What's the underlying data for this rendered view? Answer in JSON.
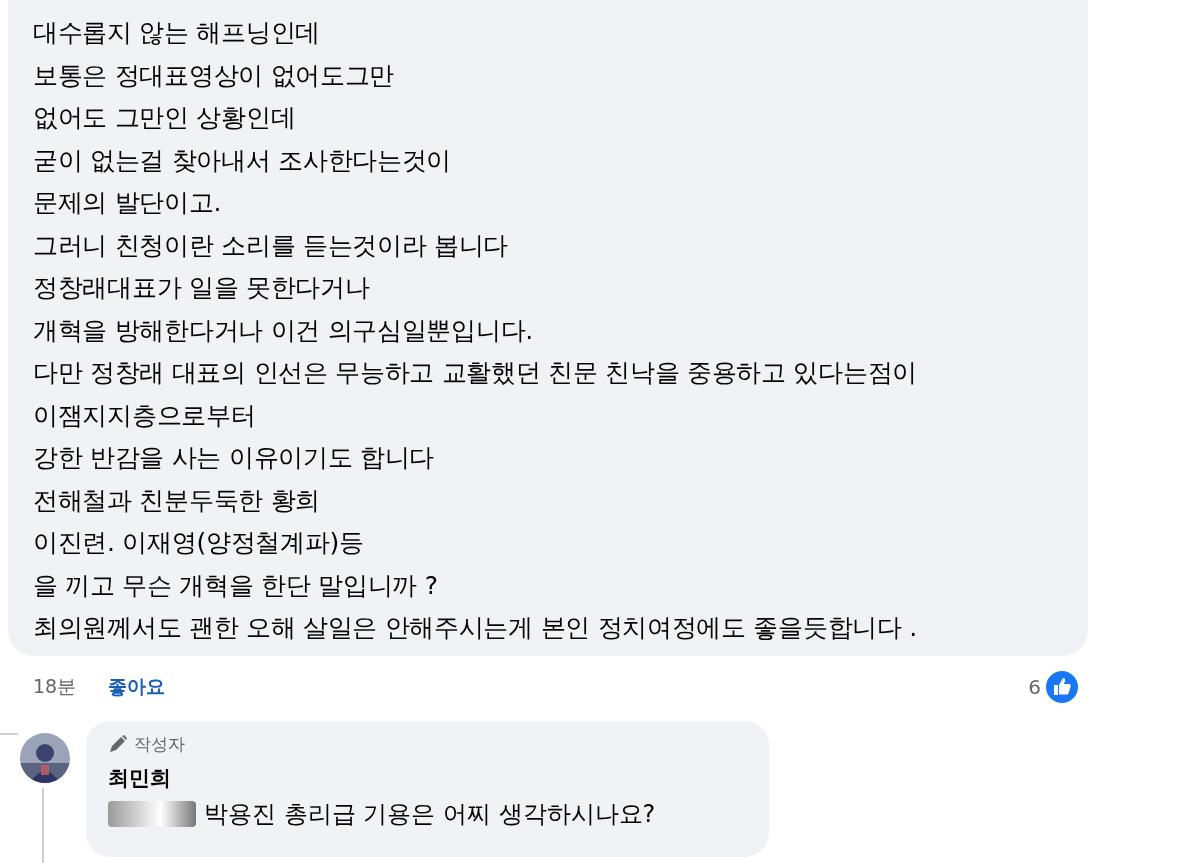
{
  "comment": {
    "lines": [
      "대수롭지 않는 해프닝인데",
      "보통은 정대표영상이 없어도그만",
      "없어도 그만인 상황인데",
      "굳이 없는걸 찾아내서 조사한다는것이",
      "문제의 발단이고.",
      "그러니 친청이란 소리를 듣는것이라 봅니다",
      "정창래대표가 일을 못한다거나",
      "개혁을 방해한다거나 이건 의구심일뿐입니다.",
      "다만 정창래 대표의 인선은 무능하고 교활했던 친문 친낙을 중용하고 있다는점이",
      "이잼지지층으로부터",
      "강한 반감을 사는 이유이기도 합니다",
      "전해철과 친분두둑한 황희",
      "이진련. 이재영(양정철계파)등",
      "을 끼고 무슨 개혁을 한단 말입니까 ?",
      "최의원께서도 괜한 오해 살일은 안해주시는게 본인 정치여정에도 좋을듯합니다 ."
    ],
    "time": "18분",
    "like_action": "좋아요",
    "reaction_count": "6"
  },
  "reply": {
    "badge": "작성자",
    "author": "최민희",
    "text": "박용진 총리급 기용은 어찌 생각하시나요?"
  }
}
